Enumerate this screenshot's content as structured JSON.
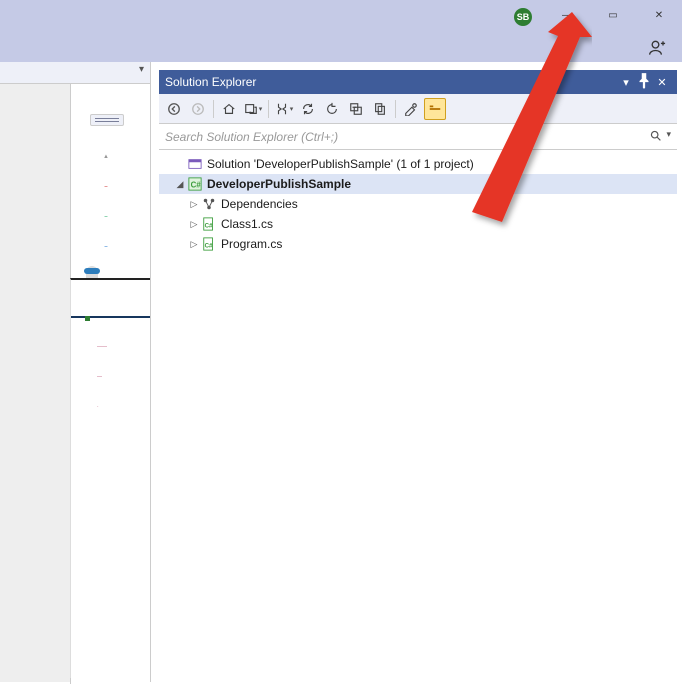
{
  "window": {
    "avatar_initials": "SB",
    "controls": {
      "min": "—",
      "max": "▭",
      "close": "✕"
    }
  },
  "solution_explorer": {
    "title": "Solution Explorer",
    "header": {
      "dropdown": "▾",
      "pin": "📌",
      "close": "✕"
    },
    "search_placeholder": "Search Solution Explorer (Ctrl+;)",
    "tree": {
      "solution_label": "Solution 'DeveloperPublishSample' (1 of 1 project)",
      "project_label": "DeveloperPublishSample",
      "items": [
        {
          "label": "Dependencies"
        },
        {
          "label": "Class1.cs"
        },
        {
          "label": "Program.cs"
        }
      ]
    }
  }
}
